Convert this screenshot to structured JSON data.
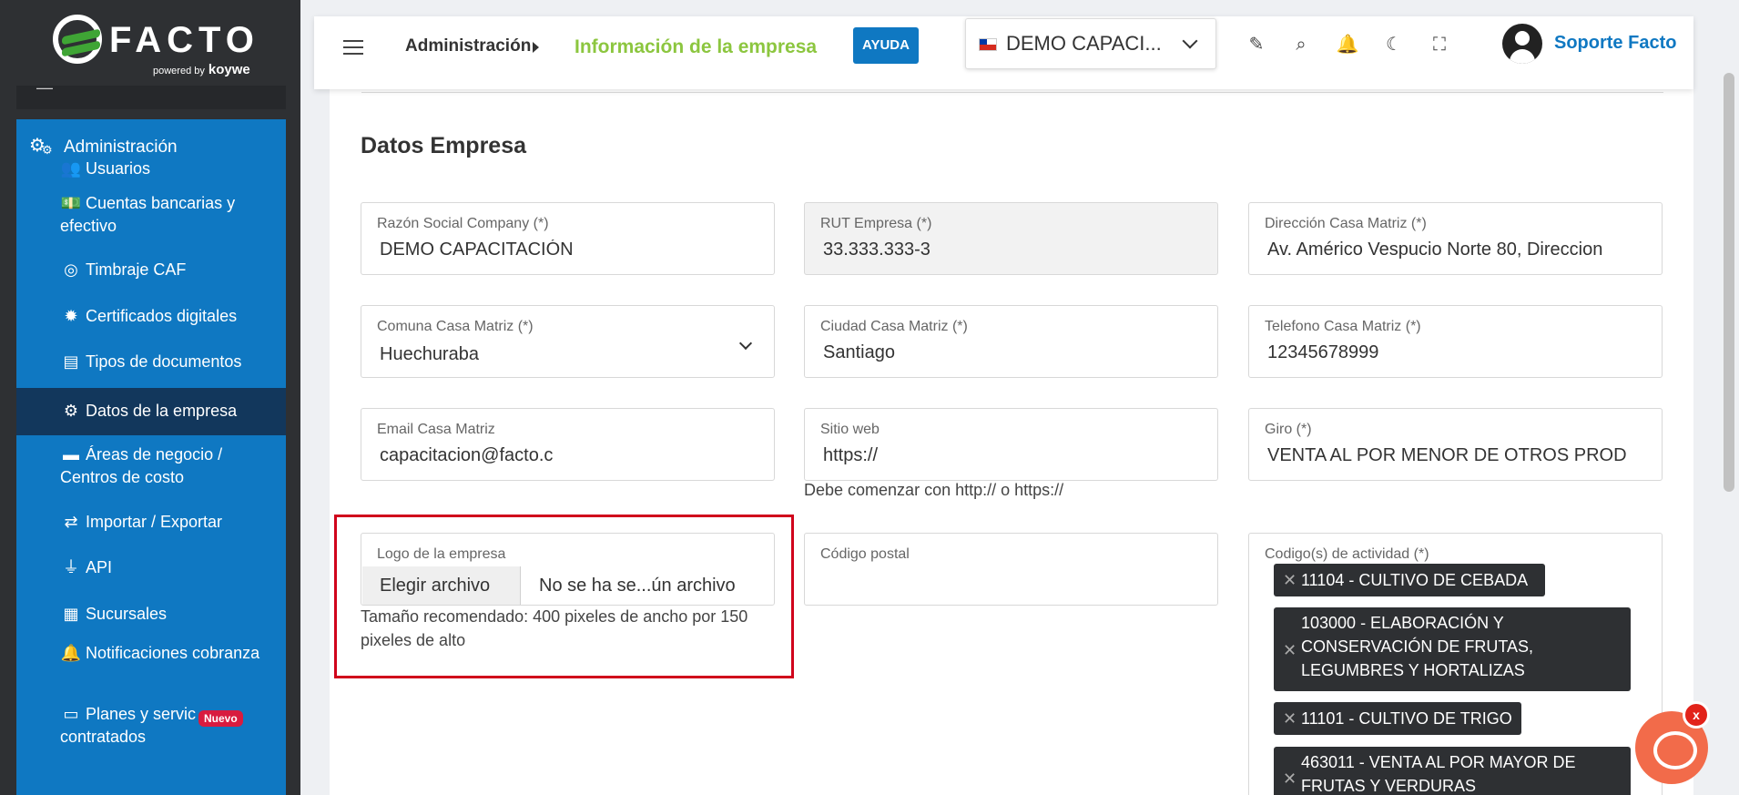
{
  "brand": {
    "name": "FACTO",
    "powered_by": "powered by",
    "partner": "koywe"
  },
  "sidebar": {
    "section_title": "Administración",
    "items": [
      {
        "label": "Usuarios",
        "icon": "users-icon"
      },
      {
        "label": "Cuentas bancarias y efectivo",
        "icon": "money-icon"
      },
      {
        "label": "Timbraje CAF",
        "icon": "stamp-icon"
      },
      {
        "label": "Certificados digitales",
        "icon": "certificate-icon"
      },
      {
        "label": "Tipos de documentos",
        "icon": "document-icon"
      },
      {
        "label": "Datos de la empresa",
        "icon": "gear-icon",
        "active": true
      },
      {
        "label": "Áreas de negocio / Centros de costo",
        "icon": "archive-icon"
      },
      {
        "label": "Importar / Exportar",
        "icon": "exchange-icon"
      },
      {
        "label": "API",
        "icon": "plug-icon"
      },
      {
        "label": "Sucursales",
        "icon": "building-icon"
      },
      {
        "label": "Notificaciones cobranza",
        "icon": "bell-icon"
      },
      {
        "label": "Planes y servic",
        "label2": "contratados",
        "icon": "plan-icon",
        "badge": "Nuevo"
      }
    ]
  },
  "header": {
    "breadcrumb_parent": "Administración",
    "breadcrumb_current": "Información de la empresa",
    "help_button": "AYUDA",
    "company": "DEMO CAPACI...",
    "user": "Soporte Facto"
  },
  "main": {
    "section_title": "Datos Empresa",
    "fields": {
      "razon_social": {
        "label": "Razón Social Company (*)",
        "value": "DEMO CAPACITACIÓN"
      },
      "rut": {
        "label": "RUT Empresa (*)",
        "value": "33.333.333-3"
      },
      "direccion": {
        "label": "Dirección Casa Matriz (*)",
        "value": "Av. Américo Vespucio Norte 80, Direccion"
      },
      "comuna": {
        "label": "Comuna Casa Matriz (*)",
        "value": "Huechuraba"
      },
      "ciudad": {
        "label": "Ciudad Casa Matriz (*)",
        "value": "Santiago"
      },
      "telefono": {
        "label": "Telefono Casa Matriz (*)",
        "value": "12345678999"
      },
      "email": {
        "label": "Email Casa Matriz",
        "value": "capacitacion@facto.c"
      },
      "sitio_web": {
        "label": "Sitio web",
        "value": "https://",
        "help": "Debe comenzar con http:// o https://"
      },
      "giro": {
        "label": "Giro (*)",
        "value": "VENTA AL POR MENOR DE OTROS PROD"
      },
      "logo": {
        "label": "Logo de la empresa",
        "button": "Elegir archivo",
        "file": "No se ha se...ún archivo",
        "help": "Tamaño recomendado: 400 pixeles de ancho por 150 pixeles de alto"
      },
      "codigo_postal": {
        "label": "Código postal",
        "value": ""
      },
      "actividad": {
        "label": "Codigo(s) de actividad (*)",
        "tags": [
          "11104 - CULTIVO DE CEBADA",
          "103000 - ELABORACIÓN Y CONSERVACIÓN DE FRUTAS, LEGUMBRES Y HORTALIZAS",
          "11101 - CULTIVO DE TRIGO",
          "463011 - VENTA AL POR MAYOR DE FRUTAS Y VERDURAS"
        ]
      }
    }
  },
  "chat": {
    "close_label": "x"
  }
}
